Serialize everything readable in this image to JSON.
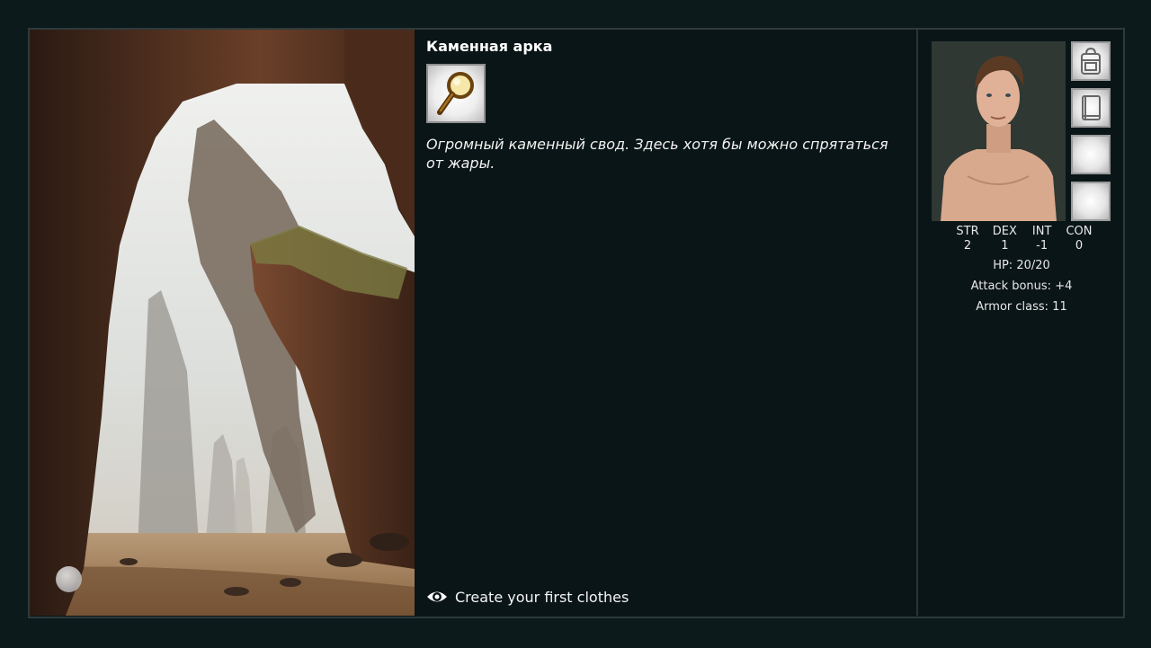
{
  "location": {
    "title": "Каменная арка",
    "description": "Огромный каменный свод. Здесь хотя бы можно спрятаться от жары."
  },
  "actions": {
    "inspect_icon": "magnifier-icon"
  },
  "quest": {
    "icon": "eye-icon",
    "label": "Create your first clothes"
  },
  "character": {
    "stats": [
      {
        "label": "STR",
        "value": "2"
      },
      {
        "label": "DEX",
        "value": "1"
      },
      {
        "label": "INT",
        "value": "-1"
      },
      {
        "label": "CON",
        "value": "0"
      }
    ],
    "hp_label": "HP:",
    "hp_value": "20/20",
    "attack_label": "Attack bonus:",
    "attack_value": "+4",
    "armor_label": "Armor class:",
    "armor_value": "11"
  },
  "side_buttons": [
    "backpack-icon",
    "book-icon",
    "empty-slot",
    "empty-slot"
  ],
  "colors": {
    "background": "#0c1a1c",
    "panel": "#0a1517",
    "border": "#2e3a3c"
  }
}
